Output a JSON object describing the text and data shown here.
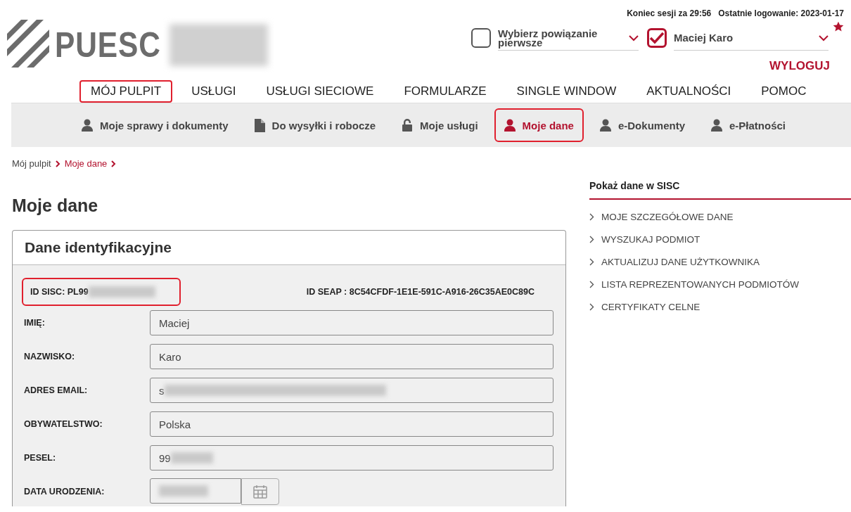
{
  "header": {
    "logo": "PUESC",
    "session": [
      "Koniec sesji za 29:56",
      "Ostatnie logowanie: 2023-01-17"
    ],
    "selectors": [
      {
        "label": "Wybierz powiązanie pierwsze",
        "checked": false,
        "starred": false
      },
      {
        "label": "Maciej Karo",
        "checked": true,
        "starred": true
      }
    ],
    "logout": "WYLOGUJ"
  },
  "main_nav": [
    {
      "label": "MÓJ PULPIT",
      "highlighted": true
    },
    {
      "label": "USŁUGI",
      "highlighted": false
    },
    {
      "label": "USŁUGI SIECIOWE",
      "highlighted": false
    },
    {
      "label": "FORMULARZE",
      "highlighted": false
    },
    {
      "label": "SINGLE WINDOW",
      "highlighted": false
    },
    {
      "label": "AKTUALNOŚCI",
      "highlighted": false
    },
    {
      "label": "POMOC",
      "highlighted": false
    }
  ],
  "sub_nav": [
    {
      "label": "Moje sprawy i dokumenty",
      "kind": "user",
      "selected": false,
      "highlighted": false
    },
    {
      "label": "Do wysyłki i robocze",
      "kind": "file",
      "selected": false,
      "highlighted": false
    },
    {
      "label": "Moje usługi",
      "kind": "unlock",
      "selected": false,
      "highlighted": false
    },
    {
      "label": "Moje dane",
      "kind": "user",
      "selected": true,
      "highlighted": true
    },
    {
      "label": "e-Dokumenty",
      "kind": "user",
      "selected": false,
      "highlighted": false
    },
    {
      "label": "e-Płatności",
      "kind": "user",
      "selected": false,
      "highlighted": false
    }
  ],
  "breadcrumb": [
    "Mój pulpit",
    "Moje dane"
  ],
  "page_title": "Moje dane",
  "card": {
    "title": "Dane identyfikacyjne",
    "id_sisc": {
      "label": "ID SISC: PL99",
      "redacted": true,
      "highlighted": true
    },
    "id_seap": "ID SEAP : 8C54CFDF-1E1E-591C-A916-26C35AE0C89C",
    "fields": [
      {
        "label": "IMIĘ:",
        "kind": "text",
        "value": "Maciej",
        "redacted": false
      },
      {
        "label": "NAZWISKO:",
        "kind": "text",
        "value": "Karo",
        "redacted": false
      },
      {
        "label": "ADRES EMAIL:",
        "kind": "text",
        "value": "s",
        "redacted": true
      },
      {
        "label": "OBYWATELSTWO:",
        "kind": "text",
        "value": "Polska",
        "redacted": false
      },
      {
        "label": "PESEL:",
        "kind": "text",
        "value": "99",
        "redacted": true
      },
      {
        "label": "DATA URODZENIA:",
        "kind": "date",
        "redacted": true
      }
    ]
  },
  "sidebar": {
    "title": "Pokaż dane w SISC",
    "links": [
      "MOJE SZCZEGÓŁOWE DANE",
      "WYSZUKAJ PODMIOT",
      "AKTUALIZUJ DANE UŻYTKOWNIKA",
      "LISTA REPREZENTOWANYCH PODMIOTÓW",
      "CERTYFIKATY CELNE"
    ]
  }
}
